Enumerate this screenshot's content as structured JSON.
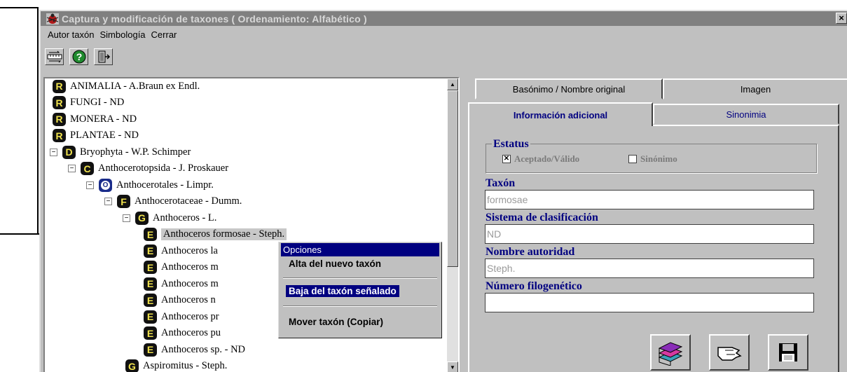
{
  "window": {
    "title": "Captura y modificación de taxones  ( Ordenamiento: Alfabético )",
    "close_label": "×"
  },
  "menu": [
    "Autor taxón",
    "Simbología",
    "Cerrar"
  ],
  "toolbar": [
    {
      "icon": "ruler-exchange-icon"
    },
    {
      "icon": "help-icon",
      "label": "?"
    },
    {
      "icon": "exit-door-icon"
    }
  ],
  "tree": {
    "nodes": [
      {
        "badge": "R",
        "text": "ANIMALIA - A.Braun ex Endl."
      },
      {
        "badge": "R",
        "text": "FUNGI - ND"
      },
      {
        "badge": "R",
        "text": "MONERA - ND"
      },
      {
        "badge": "R",
        "text": "PLANTAE - ND"
      },
      {
        "badge": "D",
        "text": "Bryophyta - W.P. Schimper",
        "expander": "−"
      },
      {
        "badge": "C",
        "text": "Anthocerotopsida - J. Proskauer",
        "expander": "−"
      },
      {
        "badge": "O",
        "text": "Anthocerotales - Limpr.",
        "expander": "−"
      },
      {
        "badge": "F",
        "text": "Anthocerotaceae - Dumm.",
        "expander": "−"
      },
      {
        "badge": "G",
        "text": "Anthoceros - L.",
        "expander": "−"
      },
      {
        "badge": "E",
        "text": "Anthoceros formosae - Steph.",
        "selected": true
      },
      {
        "badge": "E",
        "text": "Anthoceros la"
      },
      {
        "badge": "E",
        "text": "Anthoceros m"
      },
      {
        "badge": "E",
        "text": "Anthoceros m"
      },
      {
        "badge": "E",
        "text": "Anthoceros n"
      },
      {
        "badge": "E",
        "text": "Anthoceros pr"
      },
      {
        "badge": "E",
        "text": "Anthoceros pu"
      },
      {
        "badge": "E",
        "text": "Anthoceros sp. - ND"
      },
      {
        "badge": "G",
        "text": "Aspiromitus - Steph."
      }
    ],
    "scroll_up": "▲",
    "scroll_down": "▼"
  },
  "context_menu": {
    "title": "Opciones",
    "items": [
      "Alta del nuevo taxón",
      "Baja del taxón señalado",
      "Mover taxón (Copiar)"
    ],
    "highlighted_index": 1
  },
  "tabs": {
    "back_row": [
      "Basónimo / Nombre original",
      "Imagen"
    ],
    "front_row": [
      "Información adicional",
      "Sinonimia"
    ],
    "active": "Información adicional"
  },
  "form": {
    "status_group": "Estatus",
    "accepted_label": "Aceptado/Válido",
    "accepted_checked": true,
    "synonym_label": "Sinónimo",
    "synonym_checked": false,
    "taxon_label": "Taxón",
    "taxon_value": "formosae",
    "system_label": "Sistema de clasificación",
    "system_value": "ND",
    "authority_label": "Nombre autoridad",
    "authority_value": "Steph.",
    "phylo_label": "Número filogenético",
    "phylo_value": ""
  },
  "actions": [
    {
      "icon": "books-icon"
    },
    {
      "icon": "hand-pointer-icon"
    },
    {
      "icon": "floppy-disk-icon"
    }
  ],
  "colors": {
    "titlebar": "#808080",
    "label_blue": "#000080",
    "menu_highlight": "#000080",
    "badge_yellow": "#f1e34d"
  }
}
